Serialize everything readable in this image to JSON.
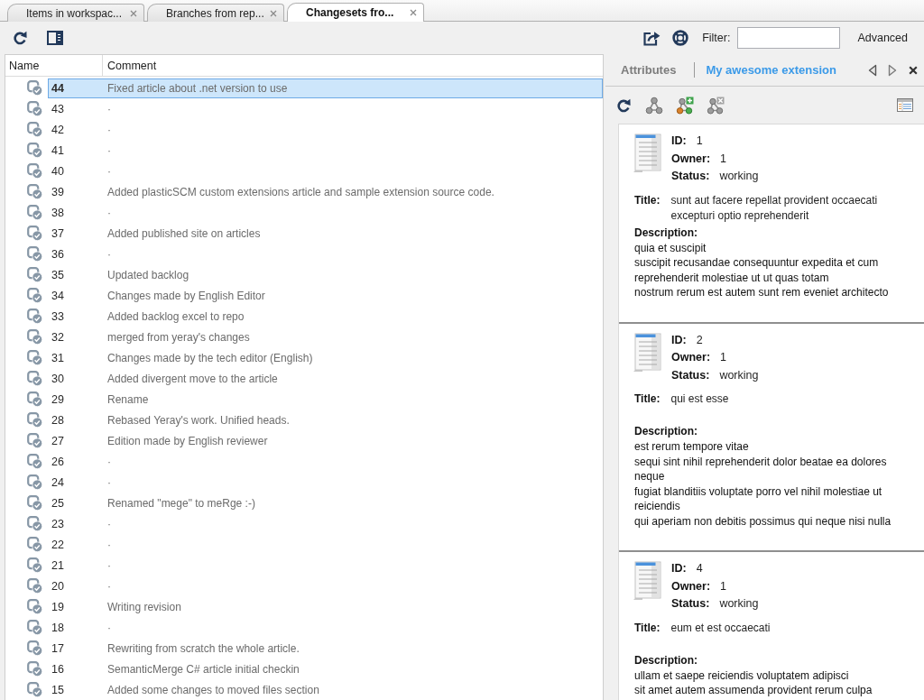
{
  "tabs": [
    {
      "label": "Items in workspac...",
      "selected": false
    },
    {
      "label": "Branches from rep...",
      "selected": false
    },
    {
      "label": "Changesets fro...",
      "selected": true
    }
  ],
  "toolbar": {
    "filter_label": "Filter:",
    "advanced": "Advanced"
  },
  "changesets": {
    "columns": [
      "Name",
      "Comment"
    ],
    "rows": [
      {
        "name": "44",
        "comment": "Fixed article about .net version to use",
        "selected": true
      },
      {
        "name": "43",
        "comment": "·",
        "selected": false
      },
      {
        "name": "42",
        "comment": "·",
        "selected": false
      },
      {
        "name": "41",
        "comment": "·",
        "selected": false
      },
      {
        "name": "40",
        "comment": "·",
        "selected": false
      },
      {
        "name": "39",
        "comment": "Added plasticSCM custom extensions article and sample extension source code.",
        "selected": false
      },
      {
        "name": "38",
        "comment": "·",
        "selected": false
      },
      {
        "name": "37",
        "comment": "Added published site on articles",
        "selected": false
      },
      {
        "name": "36",
        "comment": "·",
        "selected": false
      },
      {
        "name": "35",
        "comment": "Updated backlog",
        "selected": false
      },
      {
        "name": "34",
        "comment": "Changes made by English Editor",
        "selected": false
      },
      {
        "name": "33",
        "comment": "Added backlog excel to repo",
        "selected": false
      },
      {
        "name": "32",
        "comment": "merged from yeray's changes",
        "selected": false
      },
      {
        "name": "31",
        "comment": "Changes made by the tech editor (English)",
        "selected": false
      },
      {
        "name": "30",
        "comment": "Added divergent move to the article",
        "selected": false
      },
      {
        "name": "29",
        "comment": "Rename",
        "selected": false
      },
      {
        "name": "28",
        "comment": "Rebased Yeray's work. Unified heads.",
        "selected": false
      },
      {
        "name": "27",
        "comment": "Edition made by English reviewer",
        "selected": false
      },
      {
        "name": "26",
        "comment": "·",
        "selected": false
      },
      {
        "name": "24",
        "comment": "·",
        "selected": false
      },
      {
        "name": "25",
        "comment": "Renamed \"mege\" to meRge :-)",
        "selected": false
      },
      {
        "name": "23",
        "comment": "·",
        "selected": false
      },
      {
        "name": "22",
        "comment": "·",
        "selected": false
      },
      {
        "name": "21",
        "comment": "·",
        "selected": false
      },
      {
        "name": "20",
        "comment": "·",
        "selected": false
      },
      {
        "name": "19",
        "comment": "Writing revision",
        "selected": false
      },
      {
        "name": "18",
        "comment": "·",
        "selected": false
      },
      {
        "name": "17",
        "comment": "Rewriting from scratch the whole article.",
        "selected": false
      },
      {
        "name": "16",
        "comment": "SemanticMerge C# article initial checkin",
        "selected": false
      },
      {
        "name": "15",
        "comment": "Added some changes to moved files section",
        "selected": false
      }
    ]
  },
  "details": {
    "tabs": [
      {
        "label": "Attributes",
        "selected": false
      },
      {
        "label": "My awesome extension",
        "selected": true
      }
    ],
    "items": [
      {
        "fields": [
          {
            "label": "ID:",
            "value": "1"
          },
          {
            "label": "Owner:",
            "value": "1"
          },
          {
            "label": "Status:",
            "value": "working"
          }
        ],
        "title": {
          "label": "Title:",
          "value": "sunt aut facere repellat provident occaecati excepturi optio reprehenderit"
        },
        "description": {
          "label": "Description:",
          "value": "quia et suscipit\nsuscipit recusandae consequuntur expedita et cum\nreprehenderit molestiae ut ut quas totam\nnostrum rerum est autem sunt rem eveniet architecto"
        }
      },
      {
        "fields": [
          {
            "label": "ID:",
            "value": "2"
          },
          {
            "label": "Owner:",
            "value": "1"
          },
          {
            "label": "Status:",
            "value": "working"
          }
        ],
        "title": {
          "label": "Title:",
          "value": "qui est esse"
        },
        "description": {
          "label": "Description:",
          "value": "est rerum tempore vitae\nsequi sint nihil reprehenderit dolor beatae ea dolores neque\nfugiat blanditiis voluptate porro vel nihil molestiae ut reiciendis\nqui aperiam non debitis possimus qui neque nisi nulla"
        }
      },
      {
        "fields": [
          {
            "label": "ID:",
            "value": "4"
          },
          {
            "label": "Owner:",
            "value": "1"
          },
          {
            "label": "Status:",
            "value": "working"
          }
        ],
        "title": {
          "label": "Title:",
          "value": "eum et est occaecati"
        },
        "description": {
          "label": "Description:",
          "value": "ullam et saepe reiciendis voluptatem adipisci\nsit amet autem assumenda provident rerum culpa"
        }
      }
    ]
  }
}
